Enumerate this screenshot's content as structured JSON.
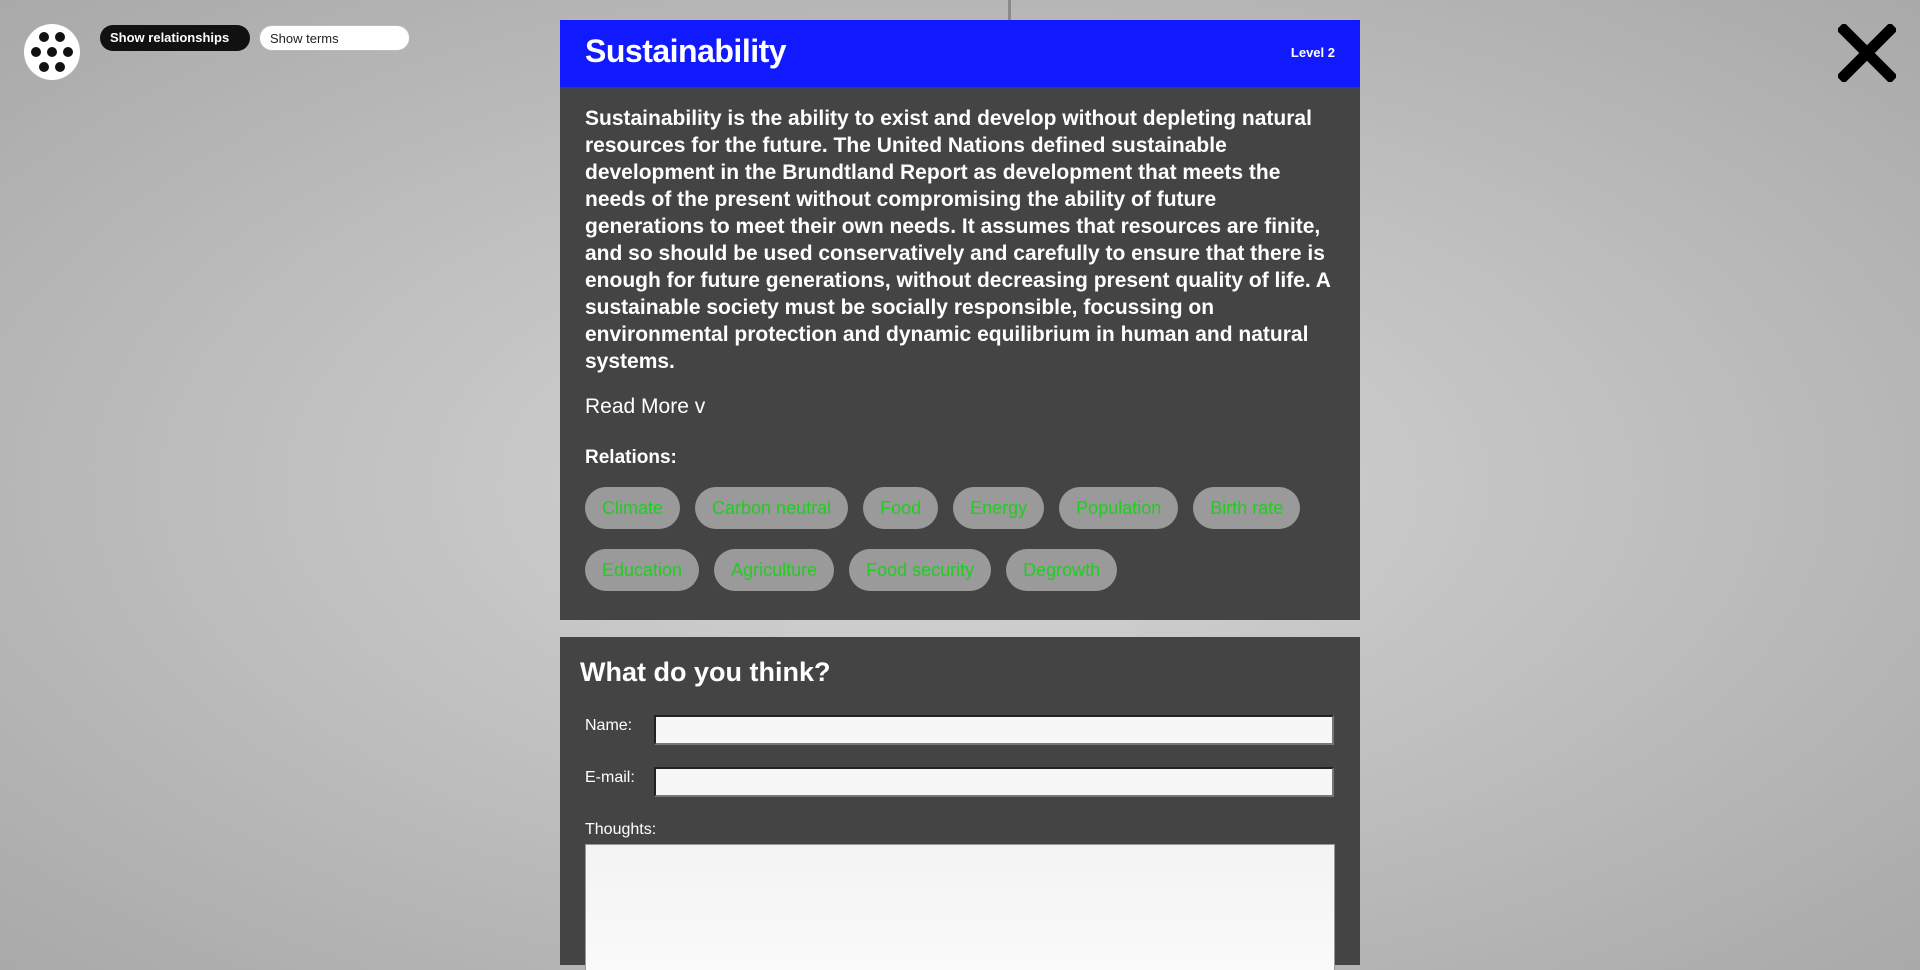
{
  "toolbar": {
    "menu_icon": "dots-circle-icon",
    "show_relationships_label": "Show relationships",
    "show_terms_label": "Show terms",
    "close_icon": "close-icon"
  },
  "card": {
    "title": "Sustainability",
    "level": "Level 2",
    "description": "Sustainability is the ability to exist and develop without depleting natural resources for the future. The United Nations defined sustainable development in the Brundtland Report as development that meets the needs of the present without compromising the ability of future generations to meet their own needs. It assumes that resources are finite, and so should be used conservatively and carefully to ensure that there is enough for future generations, without decreasing present quality of life. A sustainable society must be socially responsible, focussing on environmental protection and dynamic equilibrium in human and natural systems.",
    "read_more": "Read More v",
    "relations_label": "Relations:",
    "relations": [
      "Climate",
      "Carbon neutral",
      "Food",
      "Energy",
      "Population",
      "Birth rate",
      "Education",
      "Agriculture",
      "Food security",
      "Degrowth"
    ],
    "colors": {
      "header": "#1119ff",
      "panel": "#444444",
      "chip_bg": "#9a9a9a",
      "chip_text": "#22cc22"
    }
  },
  "form": {
    "title": "What do you think?",
    "name_label": "Name:",
    "name_value": "",
    "email_label": "E-mail:",
    "email_value": "",
    "thoughts_label": "Thoughts:",
    "thoughts_value": ""
  }
}
